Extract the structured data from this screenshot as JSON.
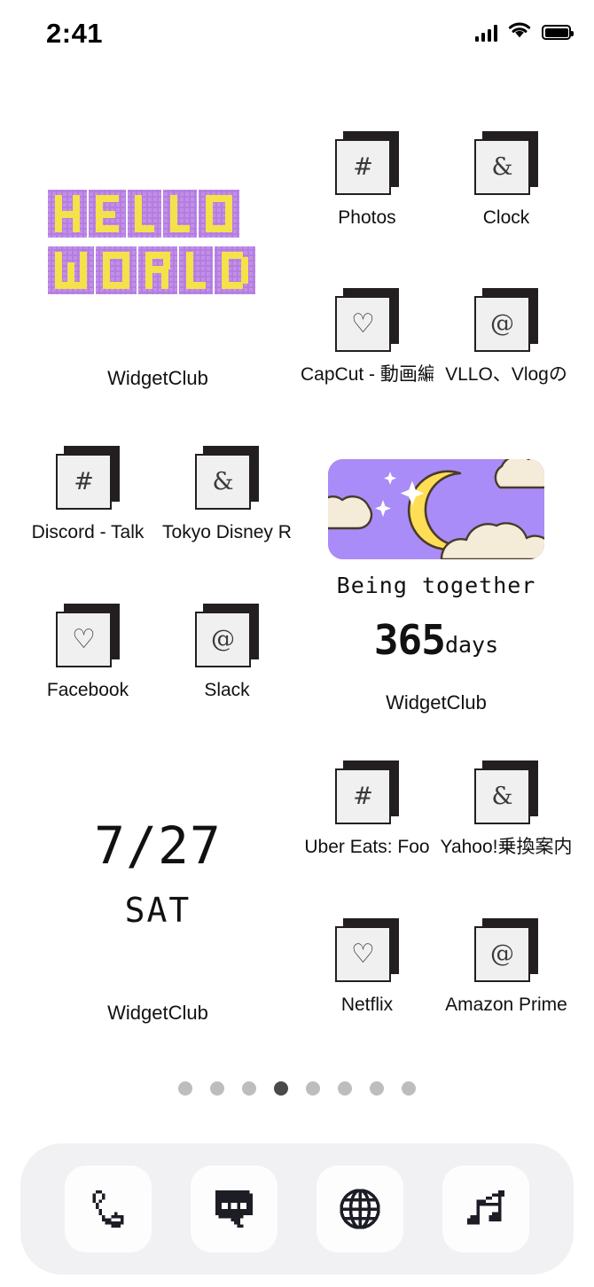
{
  "status_bar": {
    "time": "2:41",
    "signal_icon": "cellular-signal-icon",
    "wifi_icon": "wifi-icon",
    "battery_icon": "battery-full-icon"
  },
  "theme": {
    "background": "#ffffff",
    "icon_face": "#f0f0f0",
    "icon_border": "#231f20",
    "icon_shadow": "#231f20",
    "widget_purple": "#a98cf7",
    "widget_yellow": "#ffdd55",
    "pixel_purple": "#b47de0",
    "pixel_yellow": "#f5e14a",
    "cloud_cream": "#f4ecd8",
    "dock_background": "#f1f1f3",
    "dock_tile": "#fdfdfd",
    "dot_inactive": "#bdbdbd",
    "dot_active": "#4a4a4a"
  },
  "widgets": {
    "hello_world": {
      "label": "WidgetClub",
      "line1": "HELLO",
      "line2": "WORLD",
      "style": "pixel-art"
    },
    "moon": {
      "label": "WidgetClub",
      "caption": "Being together",
      "count": "365",
      "unit": "days",
      "art": "crescent-moon-clouds-stars"
    },
    "date": {
      "label": "WidgetClub",
      "date": "7/27",
      "weekday": "SAT"
    }
  },
  "apps": [
    {
      "name": "Photos",
      "label": "Photos",
      "glyph": "#",
      "glyph_icon": "hash-icon"
    },
    {
      "name": "Clock",
      "label": "Clock",
      "glyph": "&",
      "glyph_icon": "ampersand-icon"
    },
    {
      "name": "CapCut",
      "label": "CapCut - 動画編",
      "glyph": "♡",
      "glyph_icon": "heart-icon"
    },
    {
      "name": "VLLO",
      "label": "VLLO、Vlogの",
      "glyph": "@",
      "glyph_icon": "at-icon"
    },
    {
      "name": "Discord",
      "label": "Discord - Talk",
      "glyph": "#",
      "glyph_icon": "hash-icon"
    },
    {
      "name": "TokyoDisney",
      "label": "Tokyo Disney R",
      "glyph": "&",
      "glyph_icon": "ampersand-icon"
    },
    {
      "name": "Facebook",
      "label": "Facebook",
      "glyph": "♡",
      "glyph_icon": "heart-icon"
    },
    {
      "name": "Slack",
      "label": "Slack",
      "glyph": "@",
      "glyph_icon": "at-icon"
    },
    {
      "name": "UberEats",
      "label": "Uber Eats: Foo",
      "glyph": "#",
      "glyph_icon": "hash-icon"
    },
    {
      "name": "YahooNorikae",
      "label": "Yahoo!乗換案内",
      "glyph": "&",
      "glyph_icon": "ampersand-icon"
    },
    {
      "name": "Netflix",
      "label": "Netflix",
      "glyph": "♡",
      "glyph_icon": "heart-icon"
    },
    {
      "name": "AmazonPrime",
      "label": "Amazon Prime",
      "glyph": "@",
      "glyph_icon": "at-icon"
    }
  ],
  "page_dots": {
    "total": 8,
    "active_index": 3
  },
  "dock": [
    {
      "name": "Phone",
      "icon": "phone-icon"
    },
    {
      "name": "Messages",
      "icon": "message-bubble-icon"
    },
    {
      "name": "Safari",
      "icon": "globe-icon"
    },
    {
      "name": "Music",
      "icon": "music-note-icon"
    }
  ]
}
